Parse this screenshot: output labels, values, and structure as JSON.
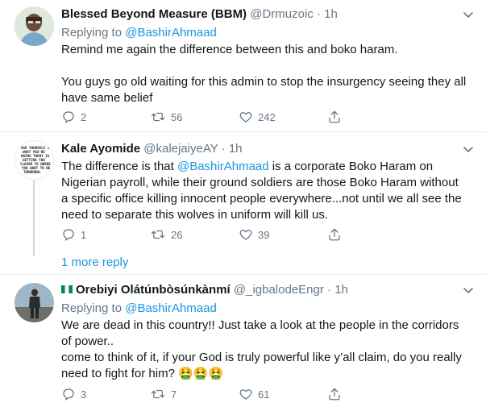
{
  "tweets": [
    {
      "name": "Blessed Beyond Measure (BBM)",
      "handle": "@Drmuzoic",
      "sep": "·",
      "time": "1h",
      "replying_prefix": "Replying to",
      "replying_to": "@BashirAhmaad",
      "text_lines": [
        "Remind me again the difference between this and boko haram.",
        "",
        "You guys go old waiting for this admin to stop the insurgency seeing they all",
        "have same belief"
      ],
      "replies": "2",
      "retweets": "56",
      "likes": "242"
    },
    {
      "name": "Kale Ayomide",
      "handle": "@kalejaiyeAY",
      "sep": "·",
      "time": "1h",
      "text_start": "The difference is that ",
      "text_mention": "@BashirAhmaad",
      "text_rest": " is a corporate Boko Haram on",
      "text_lines": [
        "Nigerian payroll,  while their ground soldiers are those Boko Haram without",
        "a specific office killing innocent people everywhere...not until we all see the",
        "need to separate this wolves in uniform will kill us."
      ],
      "replies": "1",
      "retweets": "26",
      "likes": "39",
      "avatar_text": "ASK YOURSELF IF WHAT YOU'RE DOING TODAY IS GETTING YOU CLOSER TO WHERE YOU WANT TO BE TOMORROW."
    },
    {
      "name": "Orebiyi Olátúnbòsúnkànmí",
      "handle": "@_igbalodeEngr",
      "sep": "·",
      "time": "1h",
      "replying_prefix": "Replying to",
      "replying_to": "@BashirAhmaad",
      "text_lines": [
        "We are dead in this country!! Just take a look at the people in the corridors",
        "of power..",
        "come to think of it, if your God is truly powerful like y’all claim, do you really",
        "need to fight for him? "
      ],
      "emoji": "🤮🤮🤮",
      "replies": "3",
      "retweets": "7",
      "likes": "61"
    }
  ],
  "more_replies": "1 more reply",
  "icons": {
    "reply": "reply-icon",
    "retweet": "retweet-icon",
    "like": "heart-icon",
    "share": "share-icon",
    "caret": "chevron-down-icon",
    "flag": "nigeria-flag-icon"
  },
  "colors": {
    "link": "#1b95e0",
    "secondary": "#657786",
    "divider": "#e6ecf0",
    "flag_green": "#008751"
  }
}
